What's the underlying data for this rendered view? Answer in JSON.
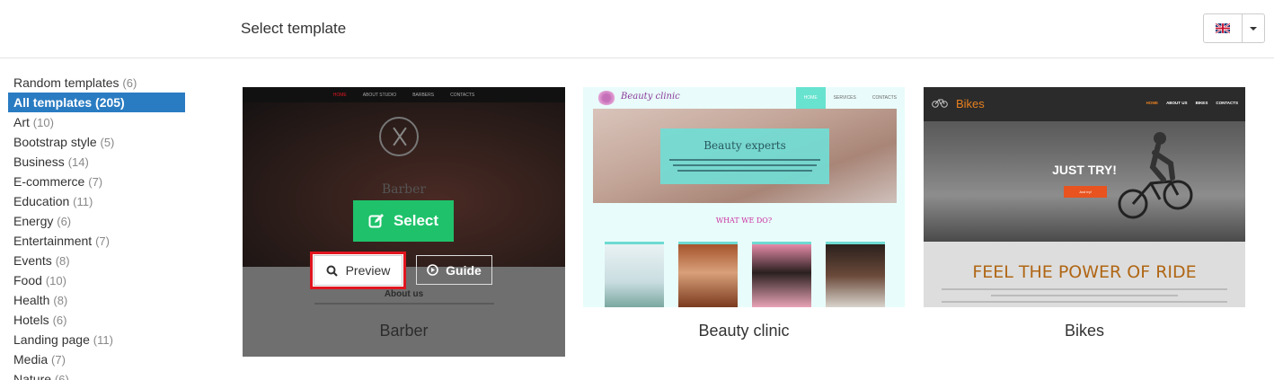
{
  "header": {
    "title": "Select template",
    "language": {
      "flag": "uk-flag-icon"
    }
  },
  "sidebar": {
    "categories": [
      {
        "label": "Random templates",
        "count": "(6)"
      },
      {
        "label": "All templates (205)",
        "count": "",
        "active": true
      },
      {
        "label": "Art",
        "count": "(10)"
      },
      {
        "label": "Bootstrap style",
        "count": "(5)"
      },
      {
        "label": "Business",
        "count": "(14)"
      },
      {
        "label": "E-commerce",
        "count": "(7)"
      },
      {
        "label": "Education",
        "count": "(11)"
      },
      {
        "label": "Energy",
        "count": "(6)"
      },
      {
        "label": "Entertainment",
        "count": "(7)"
      },
      {
        "label": "Events",
        "count": "(8)"
      },
      {
        "label": "Food",
        "count": "(10)"
      },
      {
        "label": "Health",
        "count": "(8)"
      },
      {
        "label": "Hotels",
        "count": "(6)"
      },
      {
        "label": "Landing page",
        "count": "(11)"
      },
      {
        "label": "Media",
        "count": "(7)"
      },
      {
        "label": "Nature",
        "count": "(6)"
      }
    ]
  },
  "templates": [
    {
      "name": "Barber",
      "hovered": true,
      "thumb": {
        "nav": [
          "HOME",
          "ABOUT STUDIO",
          "BARBERS",
          "CONTACTS"
        ],
        "heading": "Barber",
        "section": "About us"
      },
      "actions": {
        "select": "Select",
        "preview": "Preview",
        "guide": "Guide"
      }
    },
    {
      "name": "Beauty clinic",
      "thumb": {
        "brand": "Beauty clinic",
        "nav": [
          "HOME",
          "SERVICES",
          "CONTACTS"
        ],
        "hero_title": "Beauty experts",
        "section": "WHAT WE DO?"
      }
    },
    {
      "name": "Bikes",
      "thumb": {
        "brand": "Bikes",
        "nav": [
          "HOME",
          "ABOUT US",
          "BIKES",
          "CONTACTS"
        ],
        "hero_title": "JUST TRY!",
        "cta": "Just try!",
        "section": "FEEL THE POWER OF RIDE"
      }
    }
  ],
  "colors": {
    "accent": "#2a7cc2",
    "select": "#1fc26b",
    "highlight": "#e0161f"
  }
}
